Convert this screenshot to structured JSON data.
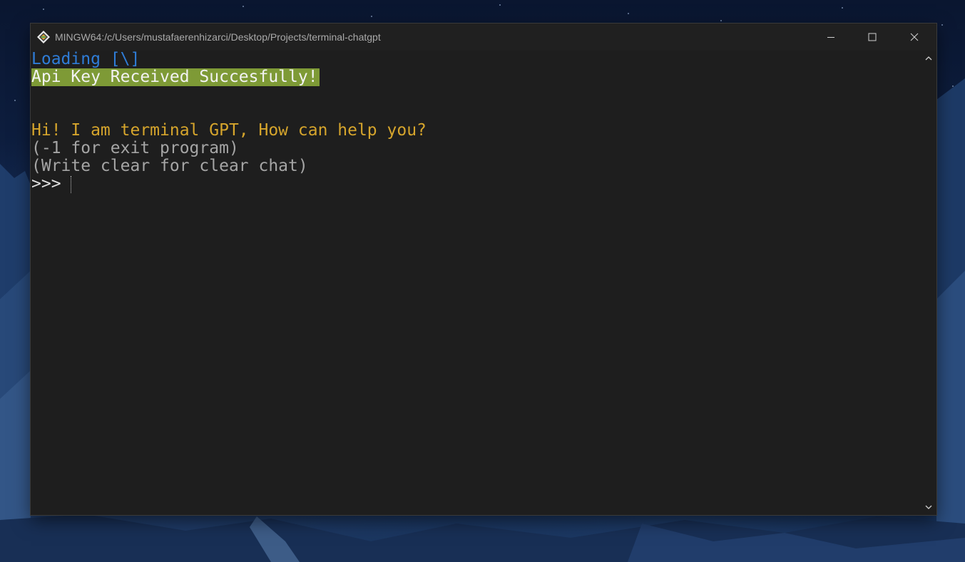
{
  "window": {
    "title": "MINGW64:/c/Users/mustafaerenhizarci/Desktop/Projects/terminal-chatgpt",
    "buttons": {
      "minimize_icon": "minimize-icon",
      "maximize_icon": "maximize-icon",
      "close_icon": "close-icon"
    }
  },
  "console": {
    "lines": [
      {
        "text": "Loading [\\]",
        "color": "#2f7dd8"
      },
      {
        "text": "Api Key Received Succesfully!",
        "color": "#f2f2f2",
        "background": "#7e9a36"
      },
      {
        "text": "Hi! I am terminal GPT, How can help you?",
        "color": "#d6a52c"
      },
      {
        "text": "(-1 for exit program)",
        "color": "#a5a5a5"
      },
      {
        "text": "(Write clear for clear chat)",
        "color": "#a5a5a5"
      }
    ],
    "prompt": ">>>"
  },
  "colors": {
    "terminal_background": "#1e1e1e",
    "titlebar_background": "#202020",
    "accent_loading": "#2f7dd8",
    "success_highlight": "#7e9a36",
    "greeting": "#d6a52c"
  }
}
